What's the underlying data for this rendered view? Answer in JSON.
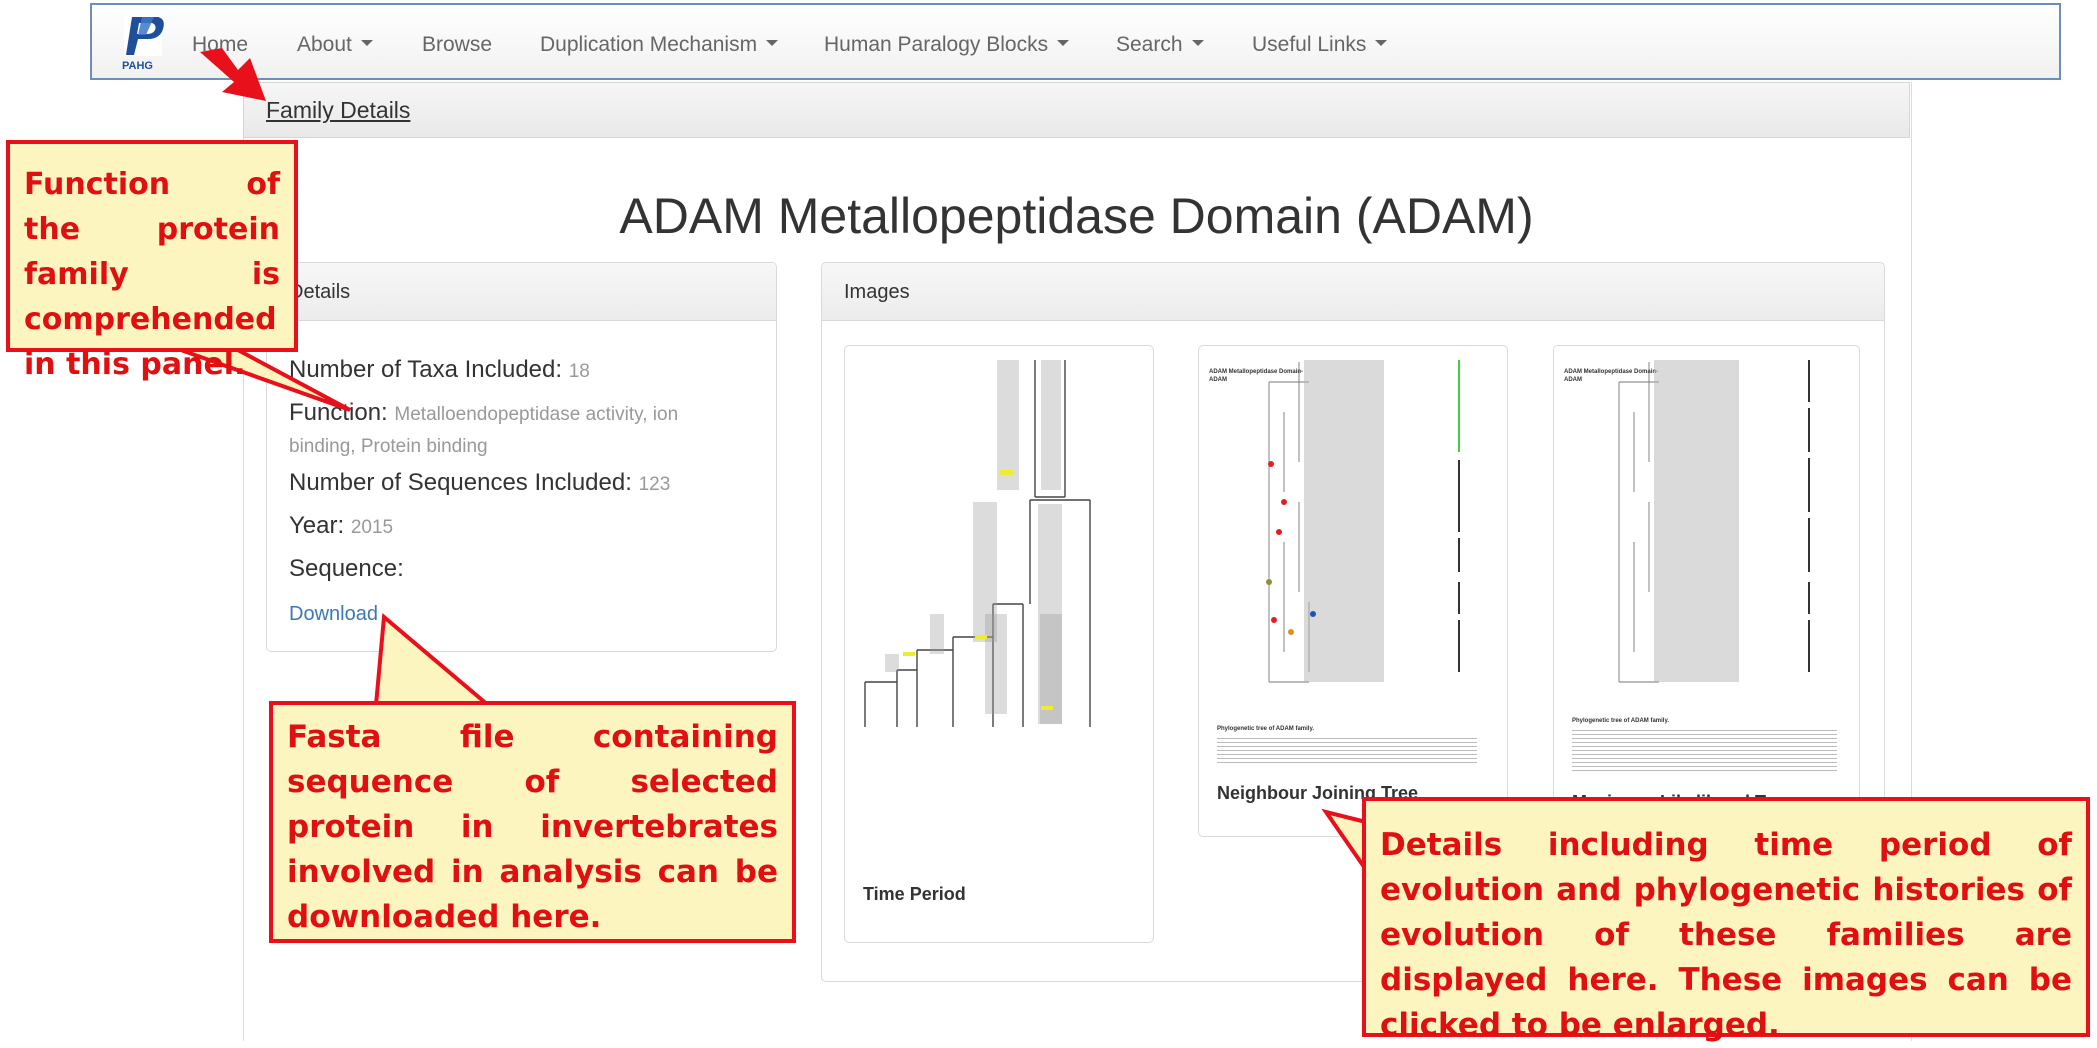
{
  "nav": {
    "logo_text": "PAHG",
    "items": [
      {
        "label": "Home",
        "dropdown": false
      },
      {
        "label": "About",
        "dropdown": true
      },
      {
        "label": "Browse",
        "dropdown": false
      },
      {
        "label": "Duplication Mechanism",
        "dropdown": true
      },
      {
        "label": "Human Paralogy Blocks",
        "dropdown": true
      },
      {
        "label": "Search",
        "dropdown": true
      },
      {
        "label": "Useful Links",
        "dropdown": true
      }
    ]
  },
  "breadcrumb": {
    "label": "Family Details"
  },
  "family": {
    "title": "ADAM Metallopeptidase Domain (ADAM)"
  },
  "details_panel": {
    "heading": "Details",
    "taxa_label": "Number of Taxa Included:",
    "taxa_value": "18",
    "function_label": "Function:",
    "function_value_line1": "Metalloendopeptidase activity, ion",
    "function_value_line2": "binding, Protein binding",
    "sequences_label": "Number of Sequences Included:",
    "sequences_value": "123",
    "year_label": "Year:",
    "year_value": "2015",
    "sequence_label": "Sequence:",
    "download_label": "Download"
  },
  "images_panel": {
    "heading": "Images",
    "thumbnails": [
      {
        "label": "Time Period"
      },
      {
        "label": "Neighbour Joining Tree",
        "tree_title": "ADAM Metallopeptidase Domain-ADAM",
        "caption_title": "Phylogenetic tree of ADAM family."
      },
      {
        "label": "Maximum Likelihood Tree",
        "tree_title": "ADAM Metallopeptidase Domain-ADAM",
        "caption_title": "Phylogenetic tree of ADAM family."
      }
    ]
  },
  "annotations": {
    "function_note": "Function of the protein family is comprehended in this panel.",
    "fasta_note": "Fasta file containing sequence of selected protein in invertebrates involved in analysis can be downloaded here.",
    "images_note": "Details including time period of evolution and phylogenetic histories of evolution of these families are displayed here. These images can be clicked to be enlarged."
  },
  "colors": {
    "callout_border": "#e8101a",
    "callout_fill": "#fdf5c0",
    "callout_text": "#e01010",
    "link": "#3a78b8",
    "navbar_border": "#6b8fb8"
  }
}
